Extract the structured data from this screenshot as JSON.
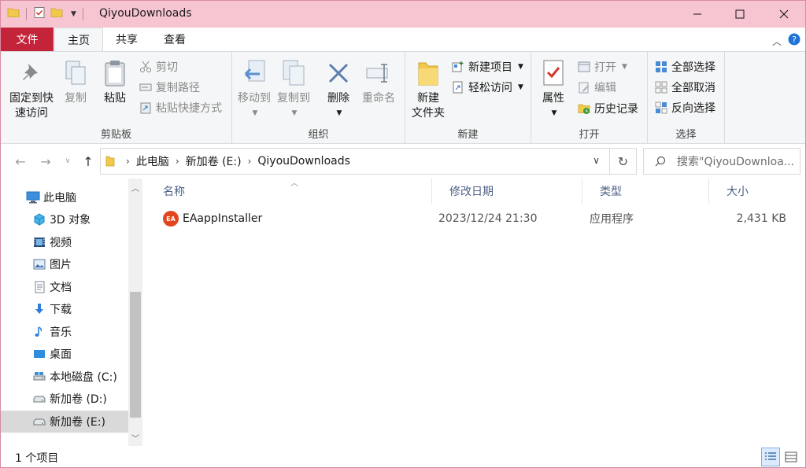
{
  "window": {
    "title": "QiyouDownloads"
  },
  "titlebar": {
    "minimize_icon": "minimize-icon",
    "maximize_icon": "maximize-icon",
    "close_icon": "close-icon"
  },
  "tabs": {
    "file": "文件",
    "home": "主页",
    "share": "共享",
    "view": "查看"
  },
  "ribbon": {
    "clipboard": {
      "label": "剪贴板",
      "pin_line1": "固定到快",
      "pin_line2": "速访问",
      "copy": "复制",
      "paste": "粘贴",
      "cut": "剪切",
      "copy_path": "复制路径",
      "paste_shortcut": "粘贴快捷方式"
    },
    "organize": {
      "label": "组织",
      "move_to": "移动到",
      "copy_to": "复制到",
      "delete": "删除",
      "rename": "重命名"
    },
    "new": {
      "label": "新建",
      "new_folder_line1": "新建",
      "new_folder_line2": "文件夹",
      "new_item": "新建项目",
      "easy_access": "轻松访问"
    },
    "open": {
      "label": "打开",
      "properties": "属性",
      "open": "打开",
      "edit": "编辑",
      "history": "历史记录"
    },
    "select": {
      "label": "选择",
      "select_all": "全部选择",
      "select_none": "全部取消",
      "invert": "反向选择"
    }
  },
  "address": {
    "crumbs": [
      "此电脑",
      "新加卷 (E:)",
      "QiyouDownloads"
    ],
    "search_placeholder": "搜索\"QiyouDownloa..."
  },
  "nav": {
    "items": [
      {
        "label": "此电脑",
        "icon": "computer-icon"
      },
      {
        "label": "3D 对象",
        "icon": "cube-icon"
      },
      {
        "label": "视频",
        "icon": "video-icon"
      },
      {
        "label": "图片",
        "icon": "picture-icon"
      },
      {
        "label": "文档",
        "icon": "document-icon"
      },
      {
        "label": "下载",
        "icon": "download-icon"
      },
      {
        "label": "音乐",
        "icon": "music-icon"
      },
      {
        "label": "桌面",
        "icon": "desktop-icon"
      },
      {
        "label": "本地磁盘 (C:)",
        "icon": "drive-icon"
      },
      {
        "label": "新加卷 (D:)",
        "icon": "drive-icon"
      },
      {
        "label": "新加卷 (E:)",
        "icon": "drive-icon"
      }
    ]
  },
  "columns": {
    "name": "名称",
    "modified": "修改日期",
    "type": "类型",
    "size": "大小"
  },
  "files": [
    {
      "name": "EAappInstaller",
      "modified": "2023/12/24 21:30",
      "type": "应用程序",
      "size": "2,431 KB",
      "icon_text": "EA"
    }
  ],
  "status": {
    "count": "1 个项目"
  },
  "colors": {
    "file_tab": "#c4243a",
    "titlebar": "#f7c5d2",
    "header_text": "#4d6185",
    "selection": "#d9d9d9"
  }
}
